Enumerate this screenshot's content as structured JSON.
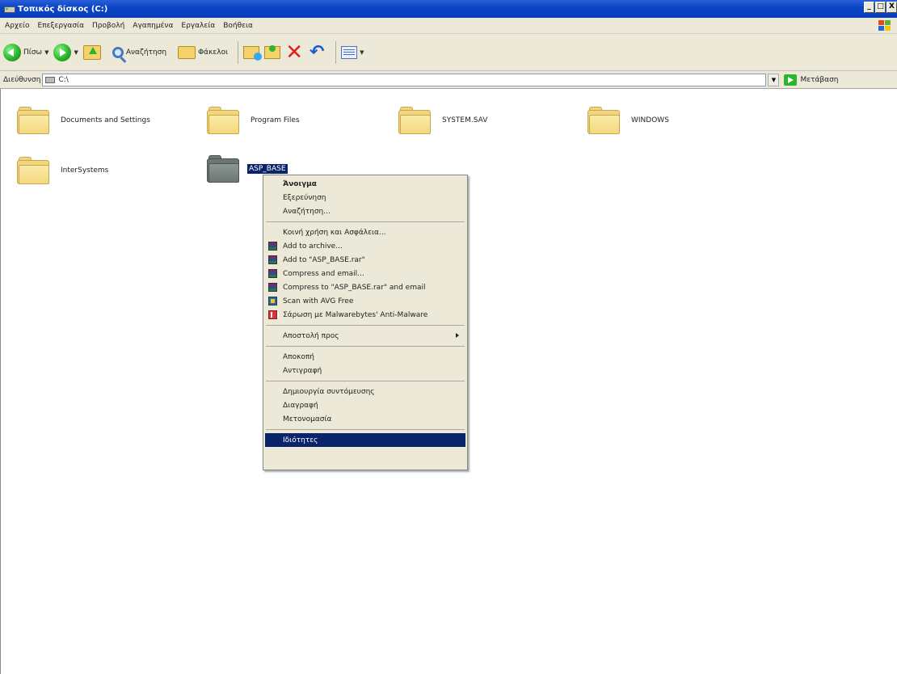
{
  "window": {
    "title": "Τοπικός δίσκος (C:)",
    "buttons": [
      "_",
      "□",
      "X"
    ]
  },
  "menubar": [
    "Αρχείο",
    "Επεξεργασία",
    "Προβολή",
    "Αγαπημένα",
    "Εργαλεία",
    "Βοήθεια"
  ],
  "toolbar": {
    "back_label": "Πίσω",
    "search_label": "Αναζήτηση",
    "folders_label": "Φάκελοι"
  },
  "address": {
    "label": "Διεύθυνση",
    "value": "C:\\",
    "go_label": "Μετάβαση"
  },
  "folders": [
    {
      "name": "Documents and Settings"
    },
    {
      "name": "Program Files"
    },
    {
      "name": "SYSTEM.SAV"
    },
    {
      "name": "WINDOWS"
    },
    {
      "name": "InterSystems"
    },
    {
      "name": "ASP_BASE"
    }
  ],
  "context_menu": {
    "open": "Άνοιγμα",
    "explore": "Εξερεύνηση",
    "search": "Αναζήτηση...",
    "sharing": "Κοινή χρήση και Ασφάλεια...",
    "add_archive": "Add to archive...",
    "add_rar": "Add to \"ASP_BASE.rar\"",
    "compress_email": "Compress and email...",
    "compress_rar_email": "Compress to \"ASP_BASE.rar\" and email",
    "scan_avg": "Scan with AVG Free",
    "scan_mbam": "Σάρωση με Malwarebytes' Anti-Malware",
    "send_to": "Αποστολή προς",
    "cut": "Αποκοπή",
    "copy": "Αντιγραφή",
    "create_shortcut": "Δημιουργία συντόμευσης",
    "delete": "Διαγραφή",
    "rename": "Μετονομασία",
    "properties": "Ιδιότητες"
  }
}
